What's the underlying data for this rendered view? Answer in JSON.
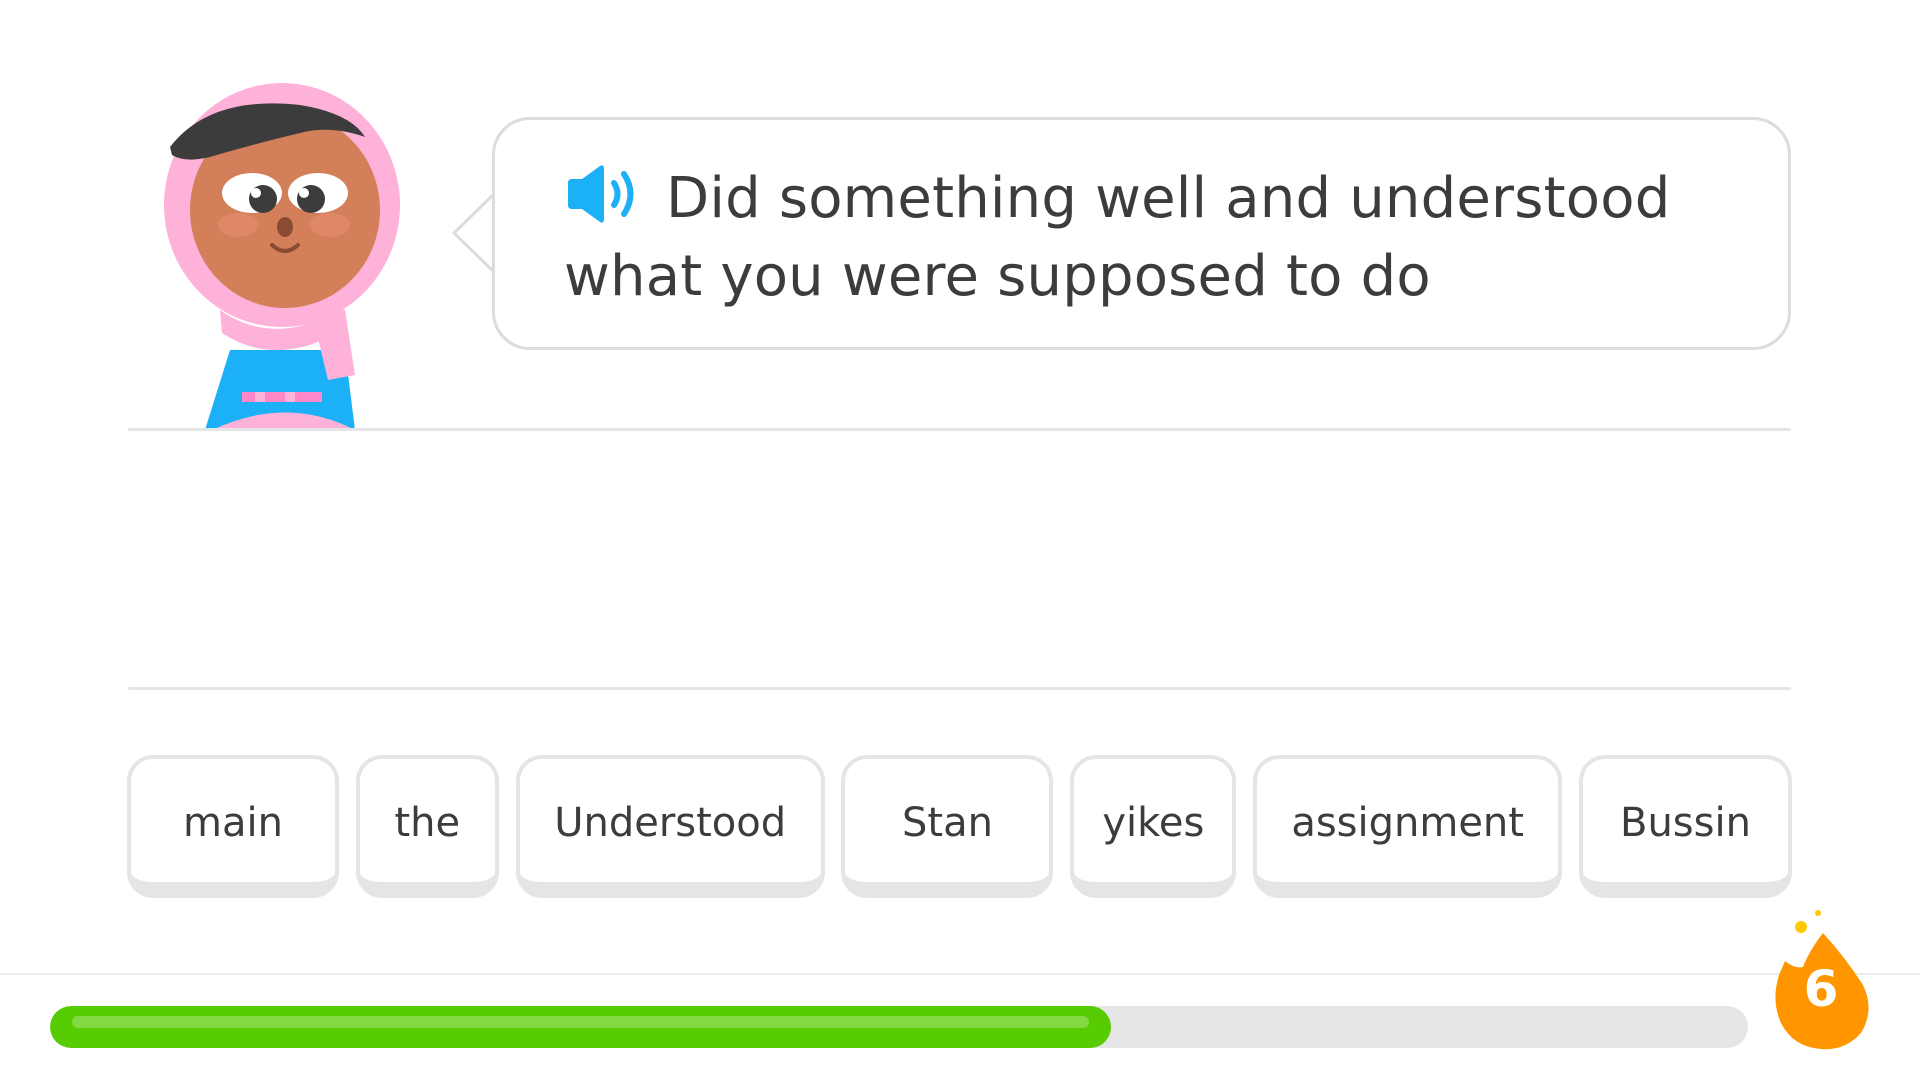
{
  "prompt": {
    "text": "Did something well and understood what you were supposed to do"
  },
  "word_bank": [
    {
      "label": "main"
    },
    {
      "label": "the"
    },
    {
      "label": "Understood"
    },
    {
      "label": "Stan"
    },
    {
      "label": "yikes"
    },
    {
      "label": "assignment"
    },
    {
      "label": "Bussin"
    }
  ],
  "progress": {
    "fraction": 0.625
  },
  "streak": {
    "count": "6"
  },
  "colors": {
    "accent_green": "#58cc02",
    "speaker_blue": "#1cb0f6",
    "streak_orange": "#ff9600",
    "tile_border": "#e5e5e5",
    "text": "#3c3c3c"
  },
  "icons": {
    "speaker": "speaker-icon",
    "character": "character-avatar",
    "streak": "streak-flame-icon"
  }
}
